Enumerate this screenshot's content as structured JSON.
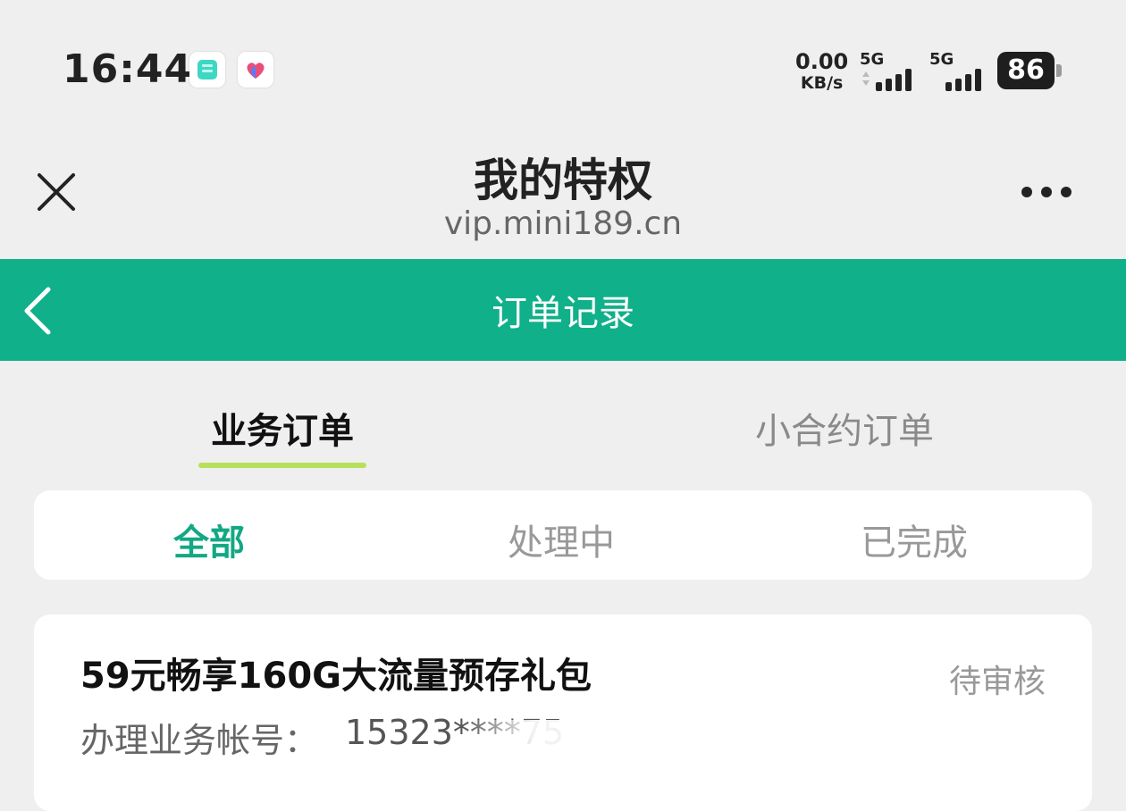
{
  "status_bar": {
    "time": "16:44",
    "net_speed_value": "0.00",
    "net_speed_unit": "KB/s",
    "signal1_label": "5G",
    "signal2_label": "5G",
    "battery": "86",
    "icons": [
      "notes-app-icon",
      "health-app-icon",
      "signal-icon",
      "battery-icon"
    ]
  },
  "title_bar": {
    "title": "我的特权",
    "url": "vip.mini189.cn"
  },
  "header": {
    "title": "订单记录"
  },
  "main_tabs": [
    {
      "label": "业务订单",
      "active": true
    },
    {
      "label": "小合约订单",
      "active": false
    }
  ],
  "filters": [
    {
      "label": "全部",
      "active": true
    },
    {
      "label": "处理中",
      "active": false
    },
    {
      "label": "已完成",
      "active": false
    }
  ],
  "order": {
    "title": "59元畅享160G大流量预存礼包",
    "status": "待审核",
    "account_label": "办理业务帐号：",
    "account_value": "15323****75"
  },
  "colors": {
    "accent": "#10b08a",
    "tab_underline": "#b7e05a",
    "active_filter": "#12a884"
  }
}
